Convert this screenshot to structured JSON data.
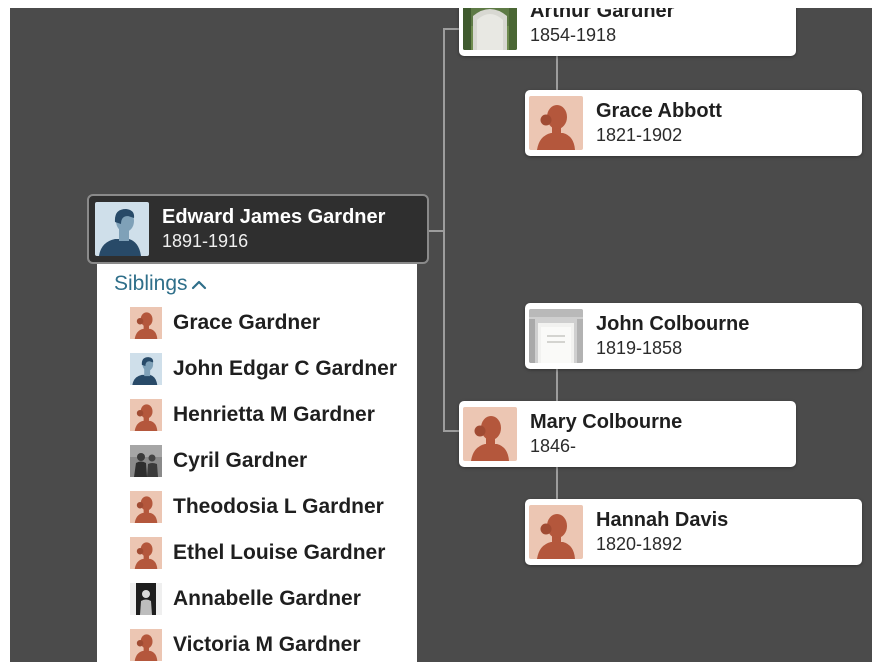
{
  "colors": {
    "canvas": "#4b4b4b",
    "connector": "#9d9d9d",
    "focus_card": "#2f2f2f",
    "link": "#2f6f8a",
    "female_avatar_bg": "#ecc6b3",
    "female_avatar_fg": "#b4573c",
    "male_avatar_bg": "#cfdfea",
    "male_avatar_fg": "#284a68"
  },
  "focus_person": {
    "name": "Edward James Gardner",
    "years": "1891-1916",
    "avatar": "male-silhouette-icon"
  },
  "siblings": {
    "toggle_label": "Siblings",
    "toggle_icon": "chevron-up-icon",
    "items": [
      {
        "name": "Grace Gardner",
        "avatar": "female-silhouette-icon"
      },
      {
        "name": "John Edgar C Gardner",
        "avatar": "male-silhouette-icon"
      },
      {
        "name": "Henrietta M Gardner",
        "avatar": "female-silhouette-icon"
      },
      {
        "name": "Cyril Gardner",
        "avatar": "photo-thumbnail"
      },
      {
        "name": "Theodosia L Gardner",
        "avatar": "female-silhouette-icon"
      },
      {
        "name": "Ethel Louise Gardner",
        "avatar": "female-silhouette-icon"
      },
      {
        "name": "Annabelle Gardner",
        "avatar": "photo-thumbnail"
      },
      {
        "name": "Victoria M Gardner",
        "avatar": "female-silhouette-icon"
      }
    ]
  },
  "tree": {
    "father": {
      "name": "Arthur Gardner",
      "years": "1854-1918",
      "avatar": "gravestone-photo"
    },
    "paternal_grandmother": {
      "name": "Grace Abbott",
      "years": "1821-1902",
      "avatar": "female-silhouette-icon"
    },
    "maternal_grandfather": {
      "name": "John Colbourne",
      "years": "1819-1858",
      "avatar": "gravestone-photo"
    },
    "mother": {
      "name": "Mary Colbourne",
      "years": "1846-",
      "avatar": "female-silhouette-icon"
    },
    "maternal_grandmother": {
      "name": "Hannah Davis",
      "years": "1820-1892",
      "avatar": "female-silhouette-icon"
    }
  }
}
